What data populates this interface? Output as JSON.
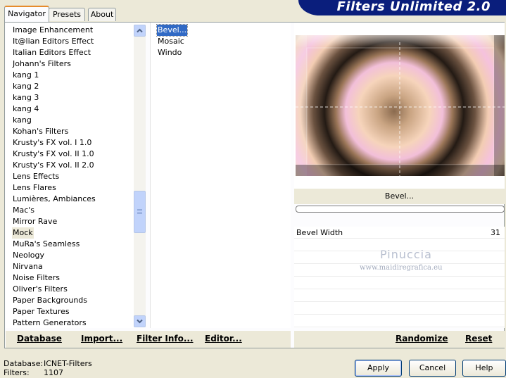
{
  "tabs": [
    {
      "label": "Navigator"
    },
    {
      "label": "Presets"
    },
    {
      "label": "About"
    }
  ],
  "banner_title": "Filters Unlimited 2.0",
  "categories": [
    "Image Enhancement",
    "It@lian Editors Effect",
    "Italian Editors Effect",
    "Johann's Filters",
    "kang 1",
    "kang 2",
    "kang 3",
    "kang 4",
    "kang",
    "Kohan's Filters",
    "Krusty's FX vol. I 1.0",
    "Krusty's FX vol. II 1.0",
    "Krusty's FX vol. II 2.0",
    "Lens Effects",
    "Lens Flares",
    "Lumières, Ambiances",
    "Mac's",
    "Mirror Rave",
    "Mock",
    "MuRa's Seamless",
    "Neology",
    "Nirvana",
    "Noise Filters",
    "Oliver's Filters",
    "Paper Backgrounds",
    "Paper Textures",
    "Pattern Generators"
  ],
  "selected_category": "Mock",
  "filters": [
    "Bevel...",
    "Mosaic",
    "Windo"
  ],
  "selected_filter": "Bevel...",
  "current_filter_label": "Bevel...",
  "params": [
    {
      "label": "Bevel Width",
      "value": "31"
    }
  ],
  "watermark": {
    "line1": "Pinuccia",
    "line2": "www.maidiregrafica.eu"
  },
  "links": {
    "database": "Database",
    "import": "Import...",
    "filter_info": "Filter Info...",
    "editor": "Editor...",
    "randomize": "Randomize",
    "reset": "Reset"
  },
  "footer": {
    "database_label": "Database:",
    "database_value": "ICNET-Filters",
    "filters_label": "Filters:",
    "filters_value": "1107"
  },
  "buttons": {
    "apply": "Apply",
    "cancel": "Cancel",
    "help": "Help"
  },
  "colors": {
    "banner": "#0a1e7c",
    "selection": "#316ac5",
    "tab_accent": "#e68b2c"
  }
}
